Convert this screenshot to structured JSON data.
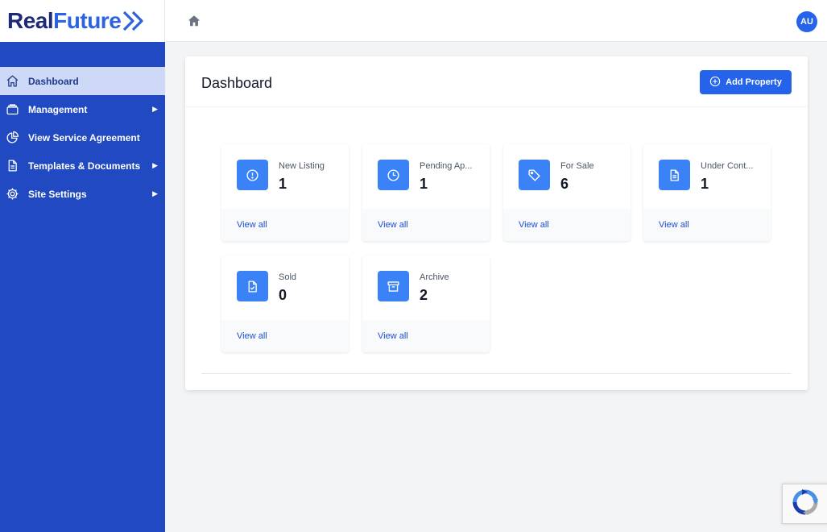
{
  "brand": {
    "part1": "Real",
    "part2": "Future"
  },
  "header": {
    "home_icon": "home-icon",
    "avatar_initials": "AU"
  },
  "sidebar": {
    "items": [
      {
        "label": "Dashboard",
        "icon": "home-outline-icon",
        "active": true,
        "has_submenu": false
      },
      {
        "label": "Management",
        "icon": "folder-icon",
        "active": false,
        "has_submenu": true
      },
      {
        "label": "View Service Agreement",
        "icon": "pie-chart-icon",
        "active": false,
        "has_submenu": false
      },
      {
        "label": "Templates & Documents",
        "icon": "document-icon",
        "active": false,
        "has_submenu": true
      },
      {
        "label": "Site Settings",
        "icon": "gear-icon",
        "active": false,
        "has_submenu": true
      }
    ],
    "submenu_caret": "▶"
  },
  "main": {
    "title": "Dashboard",
    "add_button_label": "Add Property"
  },
  "cards": [
    {
      "label": "New Listing",
      "value": "1",
      "link": "View all",
      "icon": "exclamation-circle-icon"
    },
    {
      "label": "Pending Ap...",
      "value": "1",
      "link": "View all",
      "icon": "clock-icon"
    },
    {
      "label": "For Sale",
      "value": "6",
      "link": "View all",
      "icon": "tag-icon"
    },
    {
      "label": "Under Cont...",
      "value": "1",
      "link": "View all",
      "icon": "document-icon"
    },
    {
      "label": "Sold",
      "value": "0",
      "link": "View all",
      "icon": "document-check-icon"
    },
    {
      "label": "Archive",
      "value": "2",
      "link": "View all",
      "icon": "archive-box-icon"
    }
  ],
  "colors": {
    "sidebar_bg": "#2149c1",
    "sidebar_active_bg": "#cdd9f7",
    "accent": "#2563eb",
    "card_icon_bg": "#3b82f6"
  }
}
